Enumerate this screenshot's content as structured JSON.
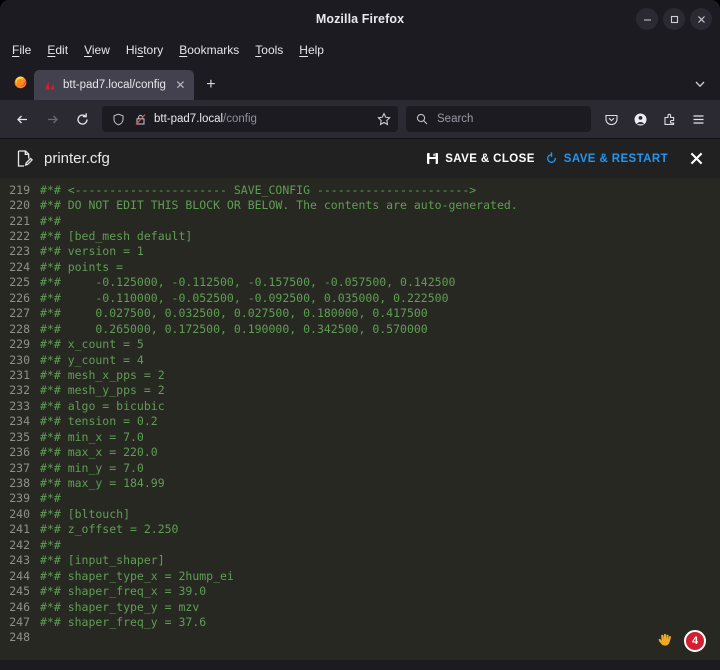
{
  "window": {
    "title": "Mozilla Firefox",
    "controls": [
      {
        "name": "minimize",
        "glyph": "–"
      },
      {
        "name": "maximize",
        "glyph": "□"
      },
      {
        "name": "close",
        "glyph": "✕"
      }
    ]
  },
  "menubar": {
    "items": [
      {
        "label": "File",
        "accel": "F"
      },
      {
        "label": "Edit",
        "accel": "E"
      },
      {
        "label": "View",
        "accel": "V"
      },
      {
        "label": "History",
        "accel": "s"
      },
      {
        "label": "Bookmarks",
        "accel": "B"
      },
      {
        "label": "Tools",
        "accel": "T"
      },
      {
        "label": "Help",
        "accel": "H"
      }
    ]
  },
  "tabs": {
    "active": {
      "title": "btt-pad7.local/config",
      "close_label": "✕",
      "favicon": "mainsail-icon"
    },
    "newtab_label": "+",
    "list_all_label": "⌄"
  },
  "navbar": {
    "back_label": "←",
    "forward_label": "→",
    "reload_label": "⟳",
    "url_host": "btt-pad7.local",
    "url_path": "/config",
    "bookmark_label": "☆",
    "search_placeholder": "Search",
    "right_icons": [
      "pocket-icon",
      "account-icon",
      "extensions-icon",
      "app-menu-icon"
    ]
  },
  "editor": {
    "filename": "printer.cfg",
    "save_close_label": "SAVE & CLOSE",
    "save_restart_label": "SAVE & RESTART",
    "close_label": "✕",
    "accent_blue": "#2196f3",
    "bg": "#272822",
    "code_color": "#5f9e54",
    "gutter_color": "#8f908a",
    "lines": [
      {
        "n": "219",
        "text": "#*# <---------------------- SAVE_CONFIG ---------------------->"
      },
      {
        "n": "220",
        "text": "#*# DO NOT EDIT THIS BLOCK OR BELOW. The contents are auto-generated."
      },
      {
        "n": "221",
        "text": "#*#"
      },
      {
        "n": "222",
        "text": "#*# [bed_mesh default]"
      },
      {
        "n": "223",
        "text": "#*# version = 1"
      },
      {
        "n": "224",
        "text": "#*# points ="
      },
      {
        "n": "225",
        "text": "#*# \t-0.125000, -0.112500, -0.157500, -0.057500, 0.142500"
      },
      {
        "n": "226",
        "text": "#*# \t-0.110000, -0.052500, -0.092500, 0.035000, 0.222500"
      },
      {
        "n": "227",
        "text": "#*# \t0.027500, 0.032500, 0.027500, 0.180000, 0.417500"
      },
      {
        "n": "228",
        "text": "#*# \t0.265000, 0.172500, 0.190000, 0.342500, 0.570000"
      },
      {
        "n": "229",
        "text": "#*# x_count = 5"
      },
      {
        "n": "230",
        "text": "#*# y_count = 4"
      },
      {
        "n": "231",
        "text": "#*# mesh_x_pps = 2"
      },
      {
        "n": "232",
        "text": "#*# mesh_y_pps = 2"
      },
      {
        "n": "233",
        "text": "#*# algo = bicubic"
      },
      {
        "n": "234",
        "text": "#*# tension = 0.2"
      },
      {
        "n": "235",
        "text": "#*# min_x = 7.0"
      },
      {
        "n": "236",
        "text": "#*# max_x = 220.0"
      },
      {
        "n": "237",
        "text": "#*# min_y = 7.0"
      },
      {
        "n": "238",
        "text": "#*# max_y = 184.99"
      },
      {
        "n": "239",
        "text": "#*#"
      },
      {
        "n": "240",
        "text": "#*# [bltouch]"
      },
      {
        "n": "241",
        "text": "#*# z_offset = 2.250"
      },
      {
        "n": "242",
        "text": "#*#"
      },
      {
        "n": "243",
        "text": "#*# [input_shaper]"
      },
      {
        "n": "244",
        "text": "#*# shaper_type_x = 2hump_ei"
      },
      {
        "n": "245",
        "text": "#*# shaper_freq_x = 39.0"
      },
      {
        "n": "246",
        "text": "#*# shaper_type_y = mzv"
      },
      {
        "n": "247",
        "text": "#*# shaper_freq_y = 37.6"
      },
      {
        "n": "248",
        "text": ""
      }
    ]
  },
  "overlay": {
    "hand_icon": "hand-cursor-icon",
    "badge_count": "4",
    "badge_color": "#d32030"
  }
}
